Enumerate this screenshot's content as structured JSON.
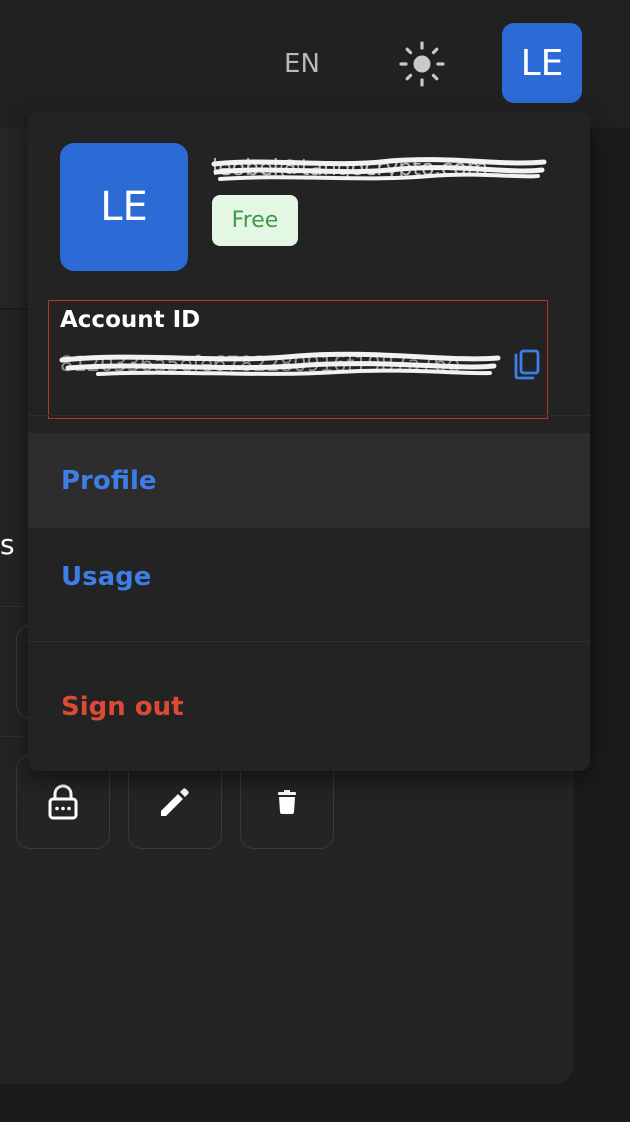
{
  "header": {
    "language_label": "EN",
    "theme_icon": "sun-icon",
    "avatar_initials": "LE",
    "accent_color": "#2c6ad6"
  },
  "background": {
    "heading_fragment": "s",
    "actions": [
      {
        "icon": "lock-icon"
      },
      {
        "icon": "pencil-icon"
      },
      {
        "icon": "trash-icon"
      }
    ]
  },
  "user_menu": {
    "avatar_initials": "LE",
    "email": "leobel@tangocrypto.com",
    "plan_badge": "Free",
    "account_id_label": "Account ID",
    "account_id_value": "8120336a5efe6782280916f1987a76e",
    "copy_icon": "copy-icon",
    "items": [
      {
        "label": "Profile",
        "color": "#3d7ee8"
      },
      {
        "label": "Usage",
        "color": "#3d7ee8"
      },
      {
        "label": "Sign out",
        "color": "#dc4a36"
      }
    ]
  }
}
